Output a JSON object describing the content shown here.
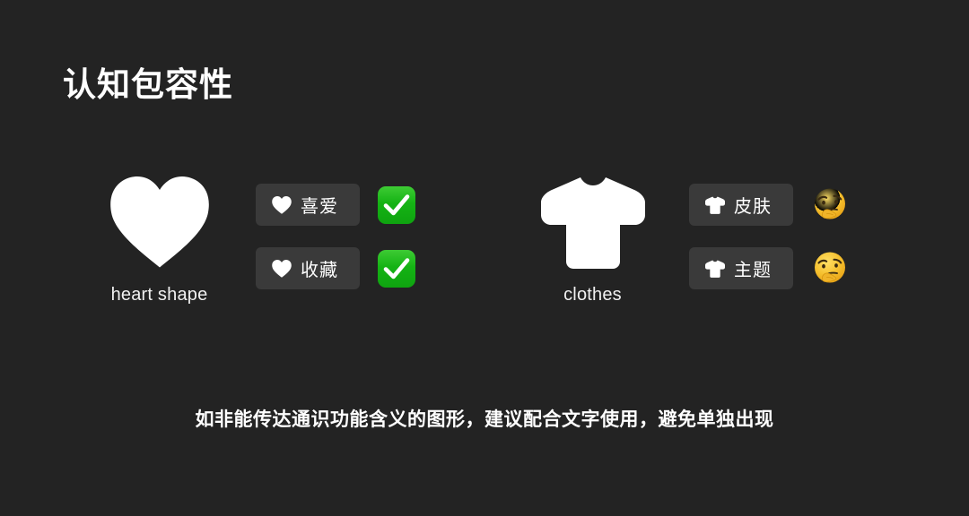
{
  "slide": {
    "title": "认知包容性",
    "background_color": "#232323",
    "footer_note": "如非能传达通识功能含义的图形，建议配合文字使用，避免单独出现"
  },
  "groups": [
    {
      "id": "heart",
      "glyph_icon": "heart-icon",
      "caption": "heart shape",
      "rows": [
        {
          "chip_icon": "heart-icon",
          "chip_label": "喜爱",
          "verdict_icon": "check-mark-button-emoji",
          "verdict_color": "#1FB01F"
        },
        {
          "chip_icon": "heart-icon",
          "chip_label": "收藏",
          "verdict_icon": "check-mark-button-emoji",
          "verdict_color": "#1FB01F"
        }
      ]
    },
    {
      "id": "clothes",
      "glyph_icon": "tshirt-icon",
      "caption": "clothes",
      "rows": [
        {
          "chip_icon": "tshirt-icon",
          "chip_label": "皮肤",
          "verdict_icon": "thinking-face-emoji",
          "verdict_color": "#F4C33A"
        },
        {
          "chip_icon": "tshirt-icon",
          "chip_label": "主题",
          "verdict_icon": "thinking-face-emoji",
          "verdict_color": "#F4C33A"
        }
      ]
    }
  ],
  "colors": {
    "chip_background": "#3a3a3a",
    "text_primary": "#ffffff",
    "glyph_white": "#ffffff"
  }
}
